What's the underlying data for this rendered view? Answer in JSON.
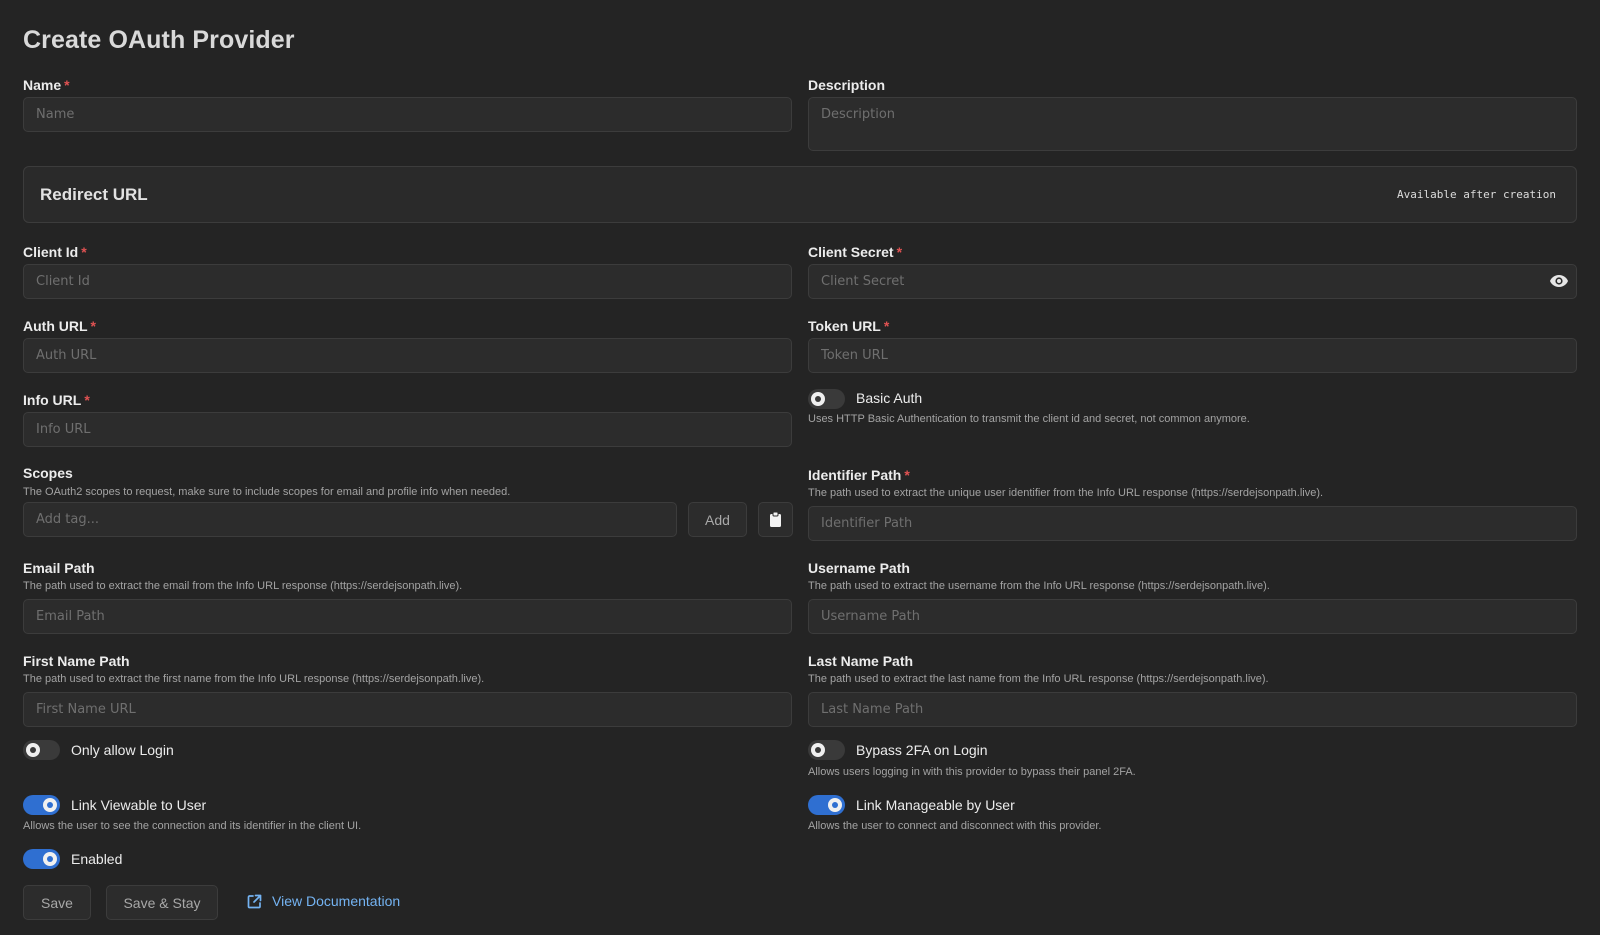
{
  "page": {
    "title": "Create OAuth Provider"
  },
  "fields": {
    "name": {
      "label": "Name",
      "placeholder": "Name",
      "value": ""
    },
    "description": {
      "label": "Description",
      "placeholder": "Description",
      "value": ""
    },
    "client_id": {
      "label": "Client Id",
      "placeholder": "Client Id",
      "value": ""
    },
    "client_secret": {
      "label": "Client Secret",
      "placeholder": "Client Secret",
      "value": ""
    },
    "auth_url": {
      "label": "Auth URL",
      "placeholder": "Auth URL",
      "value": ""
    },
    "token_url": {
      "label": "Token URL",
      "placeholder": "Token URL",
      "value": ""
    },
    "info_url": {
      "label": "Info URL",
      "placeholder": "Info URL",
      "value": ""
    },
    "scopes": {
      "label": "Scopes",
      "help": "The OAuth2 scopes to request, make sure to include scopes for email and profile info when needed.",
      "placeholder": "Add tag...",
      "add_label": "Add"
    },
    "identifier_path": {
      "label": "Identifier Path",
      "help": "The path used to extract the unique user identifier from the Info URL response (https://serdejsonpath.live).",
      "placeholder": "Identifier Path"
    },
    "email_path": {
      "label": "Email Path",
      "help": "The path used to extract the email from the Info URL response (https://serdejsonpath.live).",
      "placeholder": "Email Path"
    },
    "username_path": {
      "label": "Username Path",
      "help": "The path used to extract the username from the Info URL response (https://serdejsonpath.live).",
      "placeholder": "Username Path"
    },
    "first_name_path": {
      "label": "First Name Path",
      "help": "The path used to extract the first name from the Info URL response (https://serdejsonpath.live).",
      "placeholder": "First Name URL"
    },
    "last_name_path": {
      "label": "Last Name Path",
      "help": "The path used to extract the last name from the Info URL response (https://serdejsonpath.live).",
      "placeholder": "Last Name Path"
    }
  },
  "redirect": {
    "title": "Redirect URL",
    "note": "Available after creation"
  },
  "toggles": {
    "basic_auth": {
      "label": "Basic Auth",
      "help": "Uses HTTP Basic Authentication to transmit the client id and secret, not common anymore.",
      "on": false
    },
    "only_allow_login": {
      "label": "Only allow Login",
      "on": false
    },
    "bypass_2fa": {
      "label": "Bypass 2FA on Login",
      "help": "Allows users logging in with this provider to bypass their panel 2FA.",
      "on": false
    },
    "link_viewable": {
      "label": "Link Viewable to User",
      "help": "Allows the user to see the connection and its identifier in the client UI.",
      "on": true
    },
    "link_manageable": {
      "label": "Link Manageable by User",
      "help": "Allows the user to connect and disconnect with this provider.",
      "on": true
    },
    "enabled": {
      "label": "Enabled",
      "on": true
    }
  },
  "actions": {
    "save": "Save",
    "save_stay": "Save & Stay",
    "view_docs": "View Documentation"
  },
  "required_marker": "*",
  "colors": {
    "background": "#242424",
    "accent": "#2f6fd1",
    "link": "#74b3f2",
    "required": "#e05252"
  },
  "icons": {
    "reveal": "eye-icon",
    "paste": "clipboard-icon",
    "docs": "external-link-icon"
  }
}
